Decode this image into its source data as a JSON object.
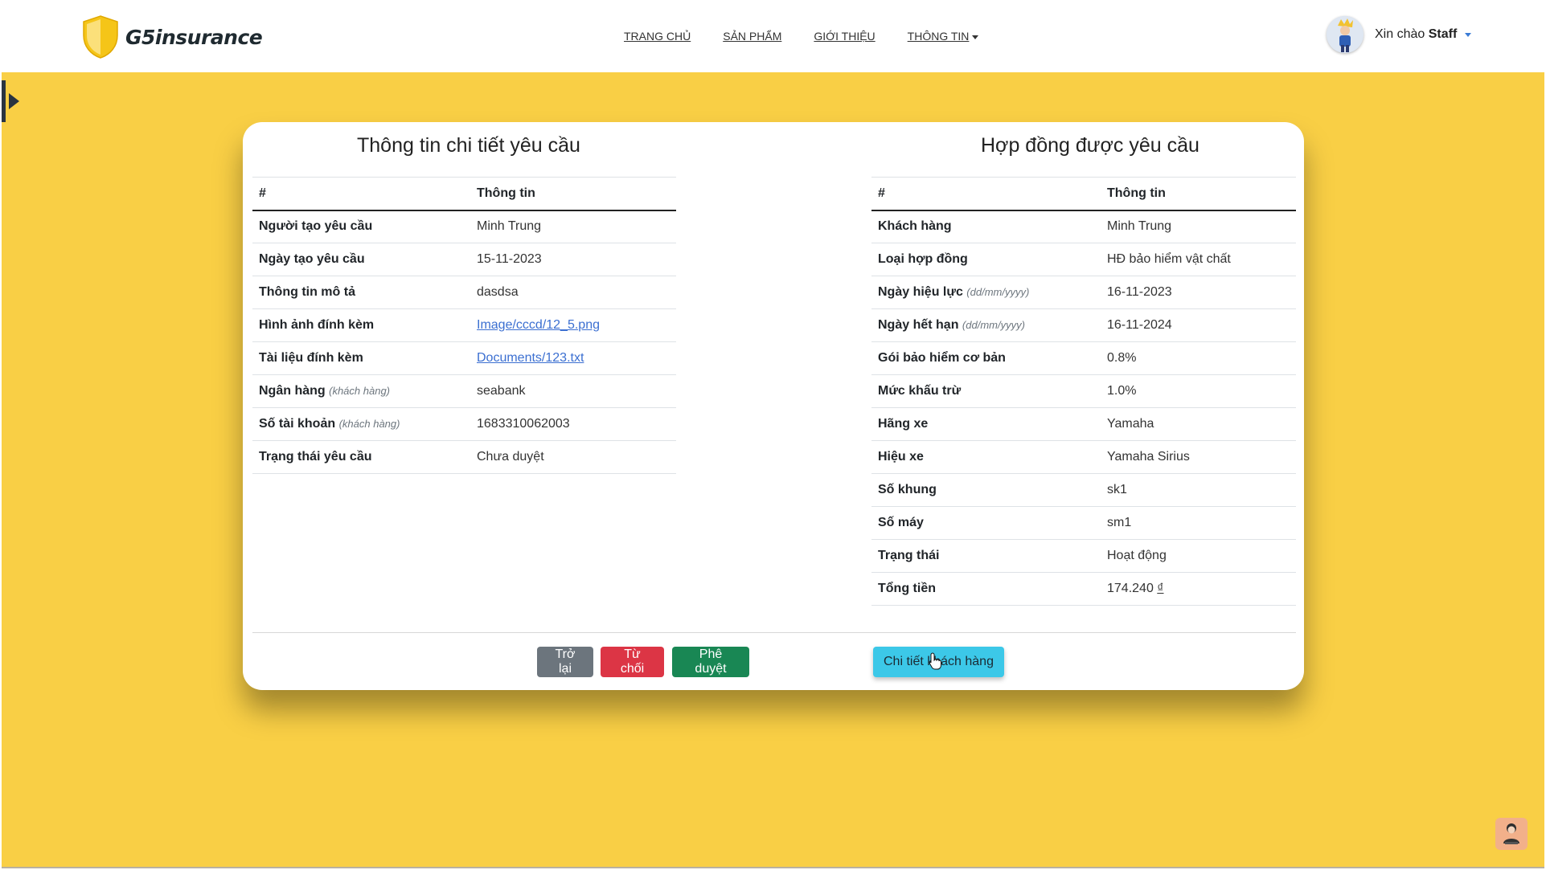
{
  "brand": {
    "name": "G5insurance"
  },
  "nav": {
    "links": [
      "TRANG CHỦ",
      "SẢN PHẨM",
      "GIỚI THIỆU",
      "THÔNG TIN"
    ]
  },
  "user": {
    "greeting": "Xin chào",
    "name": "Staff"
  },
  "request_panel": {
    "title": "Thông tin chi tiết yêu cầu",
    "headers": [
      "#",
      "Thông tin"
    ],
    "rows": [
      {
        "label": "Người tạo yêu cầu",
        "value": "Minh Trung"
      },
      {
        "label": "Ngày tạo yêu cầu",
        "value": "15-11-2023"
      },
      {
        "label": "Thông tin mô tả",
        "value": "dasdsa"
      },
      {
        "label": "Hình ảnh đính kèm",
        "value": "Image/cccd/12_5.png"
      },
      {
        "label": "Tài liệu đính kèm",
        "value": "Documents/123.txt"
      },
      {
        "label": "Ngân hàng",
        "hint": "(khách hàng)",
        "value": "seabank"
      },
      {
        "label": "Số tài khoản",
        "hint": "(khách hàng)",
        "value": "1683310062003"
      },
      {
        "label": "Trạng thái yêu cầu",
        "value": "Chưa duyệt"
      }
    ]
  },
  "contract_panel": {
    "title": "Hợp đồng được yêu cầu",
    "headers": [
      "#",
      "Thông tin"
    ],
    "rows": [
      {
        "label": "Khách hàng",
        "value": "Minh Trung"
      },
      {
        "label": "Loại hợp đồng",
        "value": "HĐ bảo hiểm vật chất"
      },
      {
        "label": "Ngày hiệu lực",
        "hint": "(dd/mm/yyyy)",
        "value": "16-11-2023"
      },
      {
        "label": "Ngày hết hạn",
        "hint": "(dd/mm/yyyy)",
        "value": "16-11-2024"
      },
      {
        "label": "Gói bảo hiểm cơ bản",
        "value": "0.8%"
      },
      {
        "label": "Mức khấu trừ",
        "value": "1.0%"
      },
      {
        "label": "Hãng xe",
        "value": "Yamaha"
      },
      {
        "label": "Hiệu xe",
        "value": "Yamaha Sirius"
      },
      {
        "label": "Số khung",
        "value": "sk1"
      },
      {
        "label": "Số máy",
        "value": "sm1"
      },
      {
        "label": "Trạng thái",
        "value": "Hoạt động"
      },
      {
        "label": "Tổng tiền",
        "value": "174.240",
        "currency": "₫"
      }
    ]
  },
  "actions": {
    "back": "Trở lại",
    "reject": "Từ chối",
    "approve": "Phê duyệt",
    "customer_detail": "Chi tiết khách hàng"
  },
  "colors": {
    "background": "#f9cf45",
    "back_button": "#6c757d",
    "reject_button": "#dc3545",
    "approve_button": "#198754",
    "detail_button": "#3cc8e8",
    "money": "#c81e3c"
  },
  "icons": [
    "shield-logo-icon",
    "user-avatar",
    "sidebar-toggle-icon",
    "assistant-icon",
    "mouse-cursor-icon"
  ]
}
